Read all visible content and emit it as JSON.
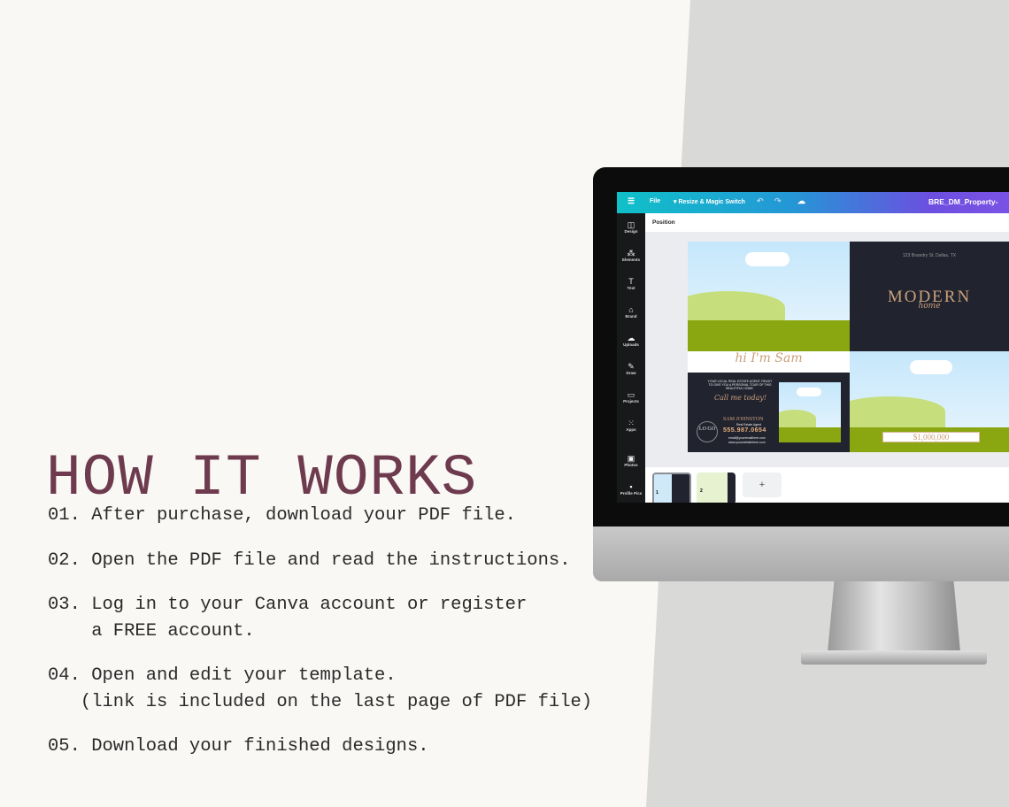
{
  "heading": "HOW IT WORKS",
  "steps": [
    "01. After purchase, download your PDF file.",
    "02. Open the PDF file and read the instructions.",
    "03. Log in to your Canva account or register\n    a FREE account.",
    "04. Open and edit your template.\n   (link is included on the last page of PDF file)",
    "05. Download your finished designs."
  ],
  "canva": {
    "menu_icon": "hamburger-icon",
    "file": "File",
    "resize": "Resize & Magic Switch",
    "doc_title": "BRE_DM_Property-",
    "position": "Position",
    "sidebar": [
      "Design",
      "Elements",
      "Text",
      "Brand",
      "Uploads",
      "Draw",
      "Projects",
      "Apps",
      "Photos",
      "Profile Pics"
    ],
    "design": {
      "address": "123 Boundry St, Dallas, TX",
      "modern": "MODERN",
      "home": "home",
      "hi": "hi I'm Sam",
      "blurb": "YOUR LOCAL REAL ESTATE AGENT, READY TO GIVE YOU A PERSONAL TOUR OF THIS BEAUTIFUL HOME.",
      "call": "Call me today!",
      "logo": "LO GO",
      "name": "SAM JOHNSTON",
      "role": "Real Estate Agent",
      "phone": "555.987.0654",
      "email": "email@youremailhere.com",
      "web": "www.yourwebsitehere.com",
      "price": "$1,000,000"
    },
    "pages": [
      "1",
      "2"
    ],
    "add_page": "+"
  },
  "colors": {
    "heading": "#6e3a4e",
    "accent": "#c9a07a"
  }
}
